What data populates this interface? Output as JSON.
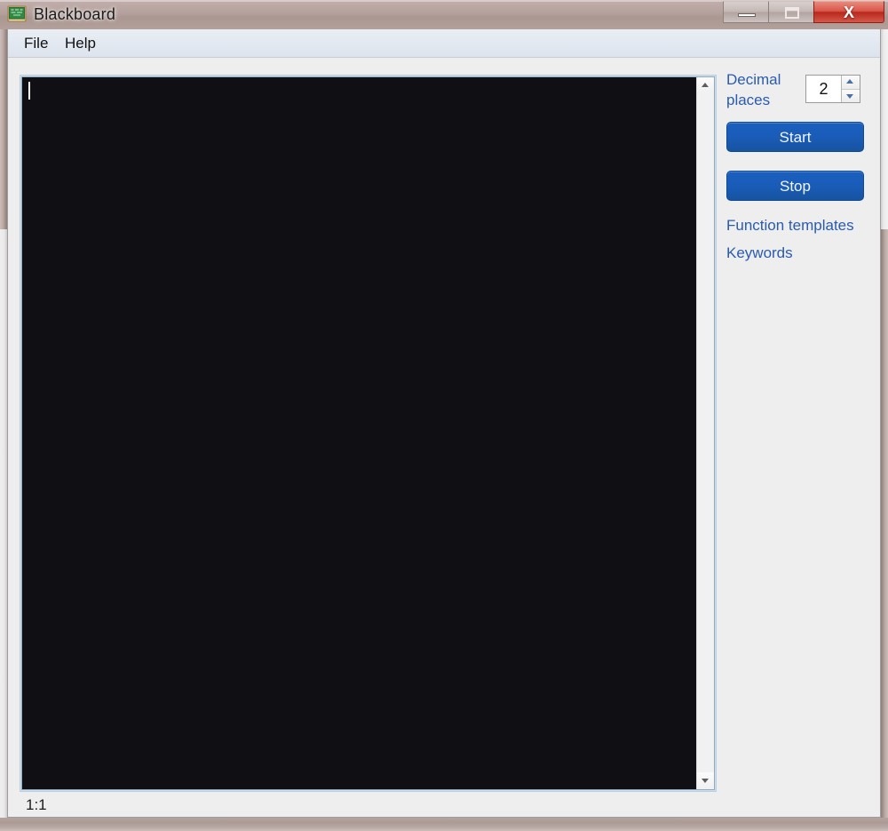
{
  "window": {
    "title": "Blackboard",
    "icon": "blackboard-icon",
    "controls": {
      "minimize": "minimize-icon",
      "maximize": "maximize-icon",
      "close": "X"
    }
  },
  "menubar": {
    "items": [
      {
        "label": "File"
      },
      {
        "label": "Help"
      }
    ]
  },
  "editor": {
    "content": "",
    "caret_visible": true,
    "background_color": "#101014",
    "border_color": "#8fa8bd",
    "scrollbar": {
      "up_arrow": "scroll-up-icon",
      "down_arrow": "scroll-down-icon"
    }
  },
  "panel": {
    "decimal_places_label": "Decimal places",
    "decimal_places_value": "2",
    "spinner": {
      "increment": "spin-up-icon",
      "decrement": "spin-down-icon"
    },
    "start_label": "Start",
    "stop_label": "Stop",
    "function_templates_label": "Function templates",
    "keywords_label": "Keywords",
    "accent_color": "#1a5cb8",
    "link_color": "#2a5bb0"
  },
  "statusbar": {
    "position": "1:1"
  }
}
